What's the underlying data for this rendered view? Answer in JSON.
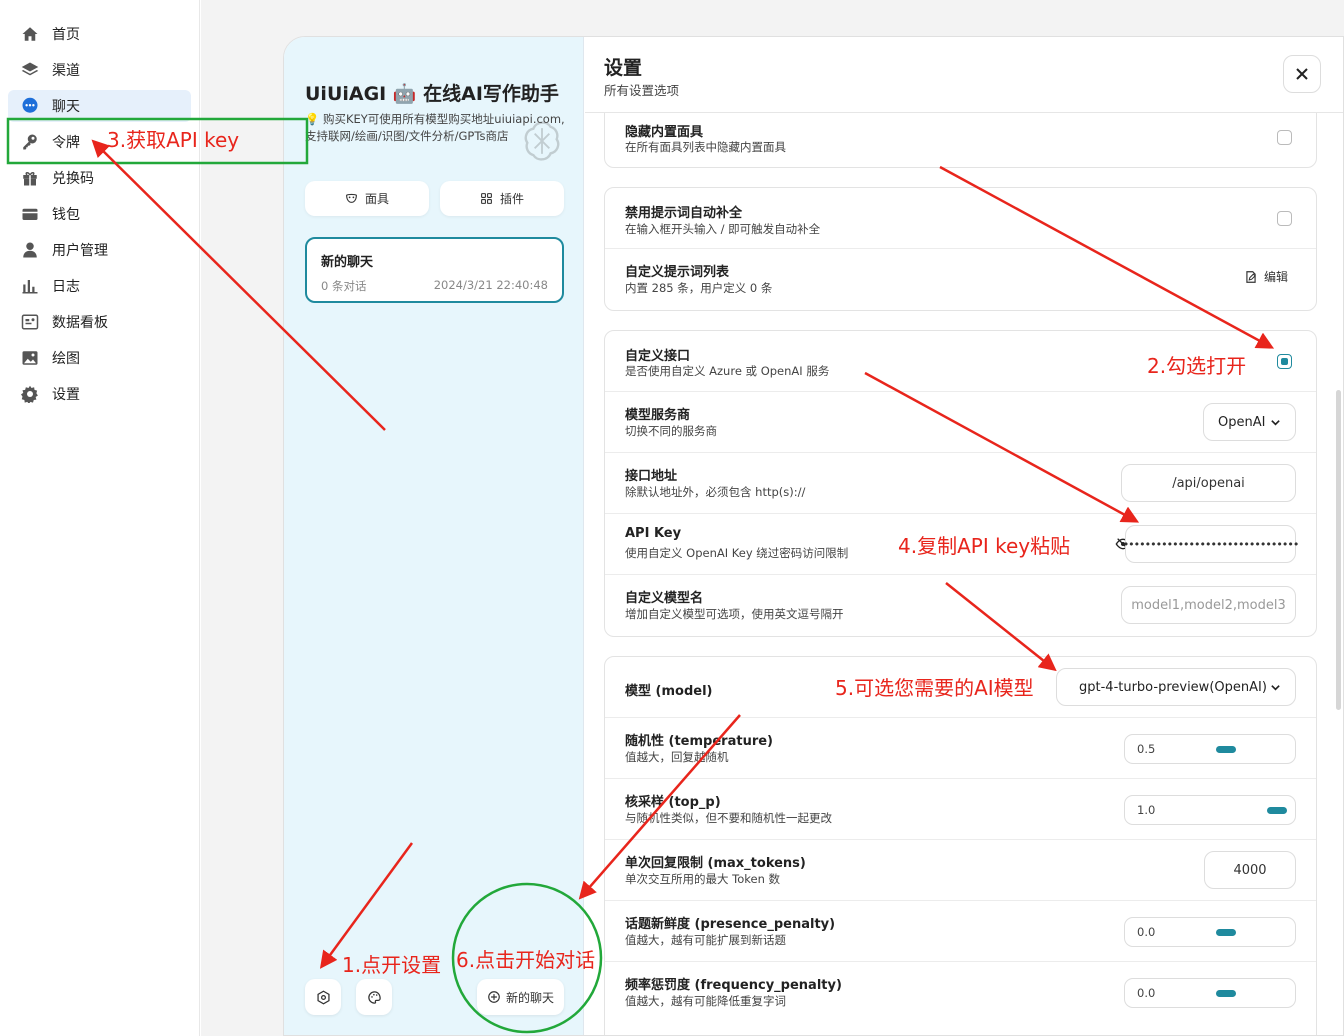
{
  "sidebar": {
    "items": [
      {
        "label": "首页",
        "icon": "home-icon"
      },
      {
        "label": "渠道",
        "icon": "layers-icon"
      },
      {
        "label": "聊天",
        "icon": "chat-icon",
        "active": true
      },
      {
        "label": "令牌",
        "icon": "key-icon"
      },
      {
        "label": "兑换码",
        "icon": "gift-icon"
      },
      {
        "label": "钱包",
        "icon": "wallet-icon"
      },
      {
        "label": "用户管理",
        "icon": "user-icon"
      },
      {
        "label": "日志",
        "icon": "bar-chart-icon"
      },
      {
        "label": "数据看板",
        "icon": "dashboard-icon"
      },
      {
        "label": "绘图",
        "icon": "image-icon"
      },
      {
        "label": "设置",
        "icon": "gear-icon"
      }
    ]
  },
  "chat_side": {
    "title": "UiUiAGI 🤖 在线AI写作助手",
    "subtitle": "💡 购买KEY可使用所有模型购买地址uiuiapi.com,支持联网/绘画/识图/文件分析/GPTs商店",
    "masks_label": "面具",
    "plugins_label": "插件",
    "chat": {
      "title": "新的聊天",
      "count": "0 条对话",
      "time": "2024/3/21 22:40:48"
    },
    "new_chat_label": "新的聊天"
  },
  "settings": {
    "title": "设置",
    "subtitle": "所有设置选项",
    "hide_masks": {
      "title": "隐藏内置面具",
      "desc": "在所有面具列表中隐藏内置面具",
      "checked": false
    },
    "disable_autocomplete": {
      "title": "禁用提示词自动补全",
      "desc": "在输入框开头输入 / 即可触发自动补全",
      "checked": false
    },
    "prompt_list": {
      "title": "自定义提示词列表",
      "desc": "内置 285 条，用户定义 0 条",
      "edit_label": "编辑"
    },
    "custom_endpoint": {
      "title": "自定义接口",
      "desc": "是否使用自定义 Azure 或 OpenAI 服务",
      "checked": true
    },
    "provider": {
      "title": "模型服务商",
      "desc": "切换不同的服务商",
      "value": "OpenAI"
    },
    "endpoint": {
      "title": "接口地址",
      "desc": "除默认地址外，必须包含 http(s)://",
      "value": "/api/openai"
    },
    "api_key": {
      "title": "API Key",
      "desc": "使用自定义 OpenAI Key 绕过密码访问限制",
      "value": "••••••••••••••••••••••••••••••••"
    },
    "custom_models": {
      "title": "自定义模型名",
      "desc": "增加自定义模型可选项，使用英文逗号隔开",
      "placeholder": "model1,model2,model3"
    },
    "model": {
      "title": "模型 (model)",
      "value": "gpt-4-turbo-preview(OpenAI)"
    },
    "temperature": {
      "title": "随机性 (temperature)",
      "desc": "值越大，回复越随机",
      "value": "0.5",
      "level": 0.5
    },
    "top_p": {
      "title": "核采样 (top_p)",
      "desc": "与随机性类似，但不要和随机性一起更改",
      "value": "1.0",
      "level": 1.0
    },
    "max_tokens": {
      "title": "单次回复限制 (max_tokens)",
      "desc": "单次交互所用的最大 Token 数",
      "value": "4000"
    },
    "presence_penalty": {
      "title": "话题新鲜度 (presence_penalty)",
      "desc": "值越大，越有可能扩展到新话题",
      "value": "0.0",
      "level": 0.5
    },
    "frequency_penalty": {
      "title": "频率惩罚度 (frequency_penalty)",
      "desc": "值越大，越有可能降低重复字词",
      "value": "0.0",
      "level": 0.5
    }
  },
  "annotations": {
    "step1": "1.点开设置",
    "step2": "2.勾选打开",
    "step3": "3.获取API key",
    "step4": "4.复制API key粘贴",
    "step5": "5.可选您需要的AI模型",
    "step6": "6.点击开始对话"
  },
  "colors": {
    "accent": "#1f8a9e",
    "annotation": "#e8251c",
    "highlight_box": "#22a83a",
    "chat_side_bg": "#e7f6fc"
  }
}
